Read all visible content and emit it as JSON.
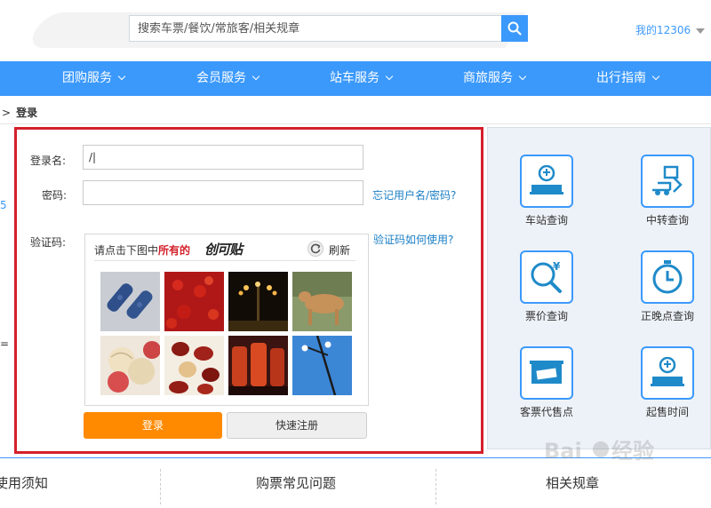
{
  "header": {
    "search_placeholder": "搜索车票/餐饮/常旅客/相关规章",
    "account_link": "我的12306"
  },
  "nav": {
    "items": [
      {
        "label": "团购服务"
      },
      {
        "label": "会员服务"
      },
      {
        "label": "站车服务"
      },
      {
        "label": "商旅服务"
      },
      {
        "label": "出行指南"
      }
    ]
  },
  "breadcrumb": {
    "arrow": ">",
    "current": "登录"
  },
  "login": {
    "username_label": "登录名:",
    "username_value": "/|",
    "password_label": "密码:",
    "forgot_link": "忘记用户名/密码?",
    "captcha_label": "验证码:",
    "captcha_help_link": "验证码如何使用?",
    "captcha_prompt_prefix": "请点击下图中",
    "captcha_prompt_emph": "所有的",
    "captcha_target": "创可贴",
    "refresh_label": "刷新",
    "captcha_tiles": [
      {
        "name": "bandage-tile"
      },
      {
        "name": "red-pepper-tile"
      },
      {
        "name": "street-lamp-night-tile"
      },
      {
        "name": "goat-tile"
      },
      {
        "name": "yarn-balls-tile"
      },
      {
        "name": "red-dates-tile"
      },
      {
        "name": "chili-jars-tile"
      },
      {
        "name": "street-lamp-sky-tile"
      }
    ],
    "login_button": "登录",
    "register_button": "快速注册"
  },
  "services": [
    {
      "label": "车站查询",
      "icon": "station-icon"
    },
    {
      "label": "中转查询",
      "icon": "transfer-icon"
    },
    {
      "label": "票价查询",
      "icon": "fare-search-icon"
    },
    {
      "label": "正晚点查询",
      "icon": "clock-icon"
    },
    {
      "label": "客票代售点",
      "icon": "ticket-agent-icon"
    },
    {
      "label": "起售时间",
      "icon": "sale-time-icon"
    }
  ],
  "footer": {
    "items": [
      {
        "label": "使用须知"
      },
      {
        "label": "购票常见问题"
      },
      {
        "label": "相关规章"
      }
    ]
  },
  "left_edge": [
    "5",
    "="
  ],
  "watermark": "Bai du 经验",
  "colors": {
    "accent": "#3b99fc",
    "highlight_frame": "#d4202b",
    "login_button": "#ff8a00"
  }
}
